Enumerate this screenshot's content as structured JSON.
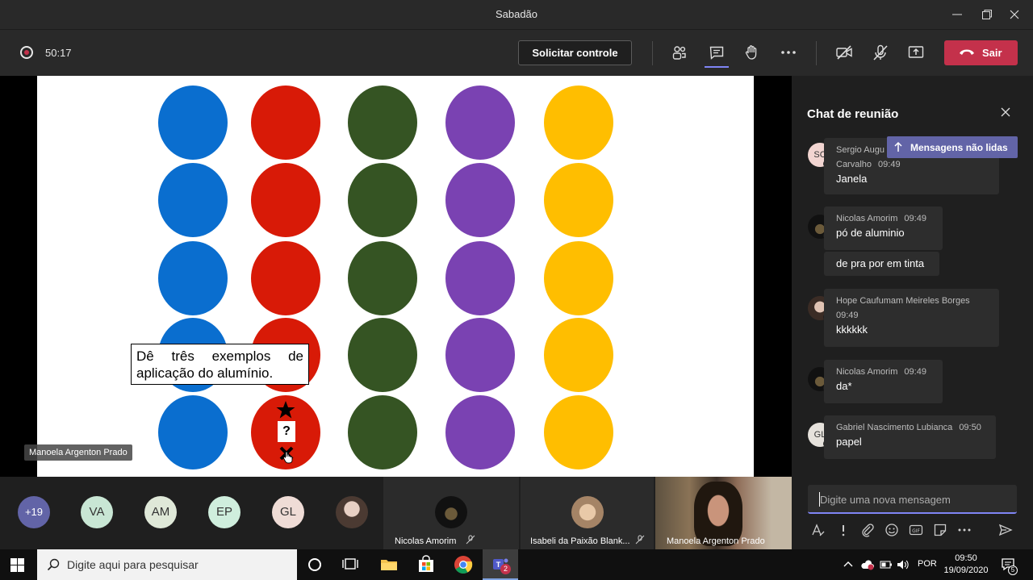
{
  "window": {
    "title": "Sabadão"
  },
  "toolbar": {
    "timer": "50:17",
    "request_control_label": "Solicitar controle",
    "leave_label": "Sair",
    "icons": [
      "participants-icon",
      "chat-icon",
      "raise-hand-icon",
      "more-icon",
      "camera-off-icon",
      "mic-off-icon",
      "share-screen-icon"
    ]
  },
  "slide": {
    "question": "Dê três exemplos de aplicação do alumínio.",
    "card_symbol": "?",
    "dot_colors": [
      "#0a6ecf",
      "#d81a07",
      "#355423",
      "#7a42b2",
      "#ffbe00"
    ]
  },
  "presenter": {
    "name": "Manoela Argenton Prado"
  },
  "participants": {
    "overflow": "+19",
    "initials": [
      "VA",
      "AM",
      "EP",
      "GL"
    ],
    "tiles": [
      {
        "name": "Nicolas Amorim"
      },
      {
        "name": "Isabeli da Paixão Blank..."
      },
      {
        "name": "Manoela Argenton Prado"
      }
    ]
  },
  "chat": {
    "title": "Chat de reunião",
    "unread_label": "Mensagens não lidas",
    "messages": [
      {
        "initials": "SC",
        "sender": "Sergio Augu",
        "sender_line2": "Carvalho",
        "time": "09:49",
        "text": "Janela"
      },
      {
        "sender": "Nicolas Amorim",
        "time": "09:49",
        "text": "pó de aluminio",
        "followup": "de pra por em tinta"
      },
      {
        "sender": "Hope Caufumam Meireles Borges",
        "time": "09:49",
        "text": "kkkkkk"
      },
      {
        "sender": "Nicolas Amorim",
        "time": "09:49",
        "text": "da*"
      },
      {
        "initials": "GL",
        "sender": "Gabriel Nascimento Lubianca",
        "time": "09:50",
        "text": "papel"
      }
    ],
    "compose_placeholder": "Digite uma nova mensagem"
  },
  "taskbar": {
    "search_placeholder": "Digite aqui para pesquisar",
    "language": "POR",
    "time": "09:50",
    "date": "19/09/2020",
    "teams_badge": "2",
    "notifications_count": "5"
  },
  "colors": {
    "accent": "#6264a7",
    "leave": "#c4314b",
    "recording": "#c4314b"
  }
}
